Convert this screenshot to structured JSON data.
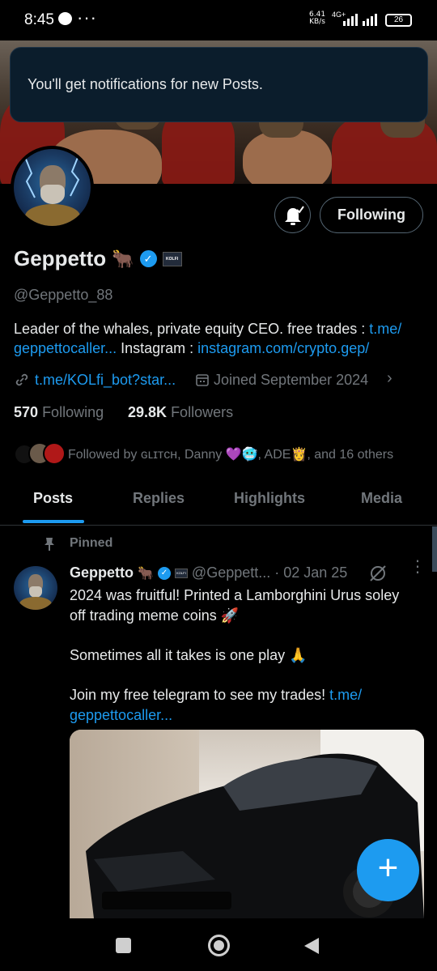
{
  "status_bar": {
    "time": "8:45",
    "more": "···",
    "net_speed": "6.41",
    "net_unit": "KB/s",
    "net_type": "4G+",
    "battery": "26"
  },
  "toast": {
    "text": "You'll get notifications for new Posts."
  },
  "profile": {
    "follow_button": "Following",
    "name": "Geppetto",
    "name_emoji": "🐂",
    "badge_label": "KOLFI",
    "handle": "@Geppetto_88",
    "bio": {
      "part1": "Leader of the whales, private equity CEO. free trades : ",
      "link1a": "t.me/",
      "link1b": "geppettocaller...",
      "part2": " Instagram : ",
      "link2": "instagram.com/crypto.gep/"
    },
    "link": "t.me/KOLfi_bot?star...",
    "joined": "Joined September 2024",
    "following_count": "570",
    "following_label": "Following",
    "followers_count": "29.8K",
    "followers_label": "Followers",
    "followed_by": {
      "prefix": "Followed by ",
      "name1": "ɢʟɪᴛᴄʜ",
      "sep1": ", Danny ",
      "emoji1": "💜🥶",
      "sep2": ", ADE",
      "emoji2": "👸",
      "suffix": ", and 16 others"
    }
  },
  "tabs": [
    "Posts",
    "Replies",
    "Highlights",
    "Media"
  ],
  "post": {
    "pinned_label": "Pinned",
    "author": "Geppetto",
    "author_emoji": "🐂",
    "handle": "@Geppett...",
    "date": "· 02 Jan 25",
    "text_line1": "2024 was fruitful! Printed a Lamborghini Urus soley",
    "text_line2": "off trading meme coins 🚀",
    "text_line3": "Sometimes all it takes is one play 🙏",
    "text_line4": "Join my free telegram to see my trades! ",
    "text_link_a": "t.me/",
    "text_link_b": "geppettocaller..."
  },
  "fab_label": "+",
  "colors": {
    "accent": "#1d9bf0",
    "background": "#000000",
    "muted": "#71767b",
    "text": "#e7e9ea"
  }
}
